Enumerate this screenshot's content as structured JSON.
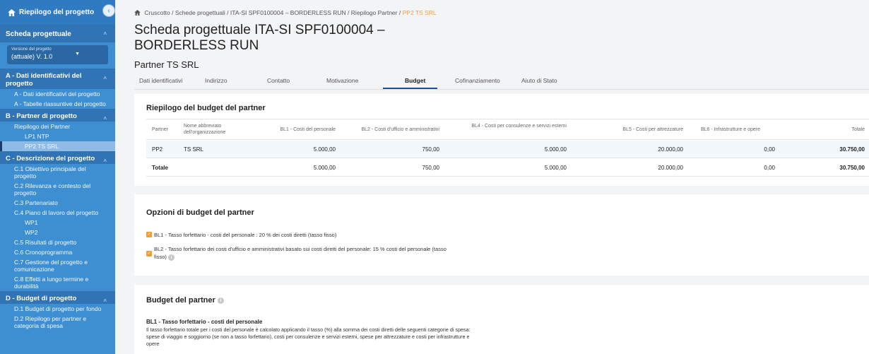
{
  "sidebar": {
    "header": "Riepilogo del progetto",
    "collapse_icon": "‹",
    "section_title": "Scheda progettuale",
    "version_label": "Versione del progetto",
    "version_value": "(attuale) V. 1.0",
    "groups": {
      "a": "A - Dati identificativi del progetto",
      "a_items": [
        "A - Dati identificativi del progetto",
        "A - Tabelle riassuntive del progetto"
      ],
      "b": "B - Partner di progetto",
      "b_item": "Riepilogo dei Partner",
      "b_subs": [
        "LP1 NTP",
        "PP2 TS SRL"
      ],
      "c": "C - Descrizione del progetto",
      "c_items": [
        "C.1 Obiettivo principale del progetto",
        "C.2 Rilevanza e contesto del progetto",
        "C.3 Partenariato",
        "C.4 Piano di lavoro del progetto"
      ],
      "c_subs": [
        "WP1",
        "WP2"
      ],
      "c_items2": [
        "C.5 Risultati di progetto",
        "C.6 Cronoprogramma",
        "C.7 Gestione del progetto e comunicazione",
        "C.8 Effetti a lungo termine e durabilità"
      ],
      "d": "D - Budget di progetto",
      "d_items": [
        "D.1 Budget di progetto per fondo",
        "D.2 Riepilogo per partner e categoria di spesa"
      ]
    }
  },
  "breadcrumb": {
    "items": [
      "Cruscotto",
      "Schede progettuali",
      "ITA-SI SPF0100004 – BORDERLESS RUN",
      "Riepilogo Partner"
    ],
    "current": "PP2 TS SRL",
    "sep": "/"
  },
  "page_title": "Scheda progettuale ITA-SI SPF0100004 – BORDERLESS RUN",
  "partner_title": "Partner TS SRL",
  "tabs": [
    "Dati identificativi",
    "Indirizzo",
    "Contatto",
    "Motivazione",
    "Budget",
    "Cofinanziamento",
    "Aiuto di Stato"
  ],
  "budget_summary": {
    "title": "Riepilogo del budget del partner",
    "headers": [
      "Partner",
      "Nome abbreviato dell'organizzazione",
      "BL1 - Costi del personale",
      "BL2 - Costi d'ufficio e amministrativi",
      "BL4 - Costi per consulenze e servizi esterni",
      "BL5 - Costi per attrezzature",
      "BL6 - Infrastrutture e opere",
      "Totale"
    ],
    "row": [
      "PP2",
      "TS SRL",
      "5.000,00",
      "750,00",
      "5.000,00",
      "20.000,00",
      "0,00",
      "30.750,00"
    ],
    "total_row": [
      "Totale",
      "5.000,00",
      "750,00",
      "5.000,00",
      "20.000,00",
      "0,00",
      "30.750,00"
    ]
  },
  "options": {
    "title": "Opzioni di budget del partner",
    "bl1": "BL1 - Tasso forfettario - costi del personale : 20 % dei costi diretti (tasso fisso)",
    "bl2": "BL2 - Tasso forfettario dei costi d'ufficio e amministrativi basato sui costi diretti del personale: 15 % costi del personale (tasso fisso)",
    "check": "✓",
    "info": "i"
  },
  "partner_budget": {
    "title": "Budget del partner",
    "bl1_title": "BL1 - Tasso forfettario - costi del personale",
    "bl1_text": "Il tasso forfettario totale per i costi del personale è calcolato applicando il tasso (%) alla somma dei costi diretti delle seguenti categorie di spesa: spese di viaggio e soggiorno (se non a tasso forfettario), costi per consulenze e servizi esterni, spese per attrezzature e costi per infrastrutture e opere"
  },
  "colors": {
    "sidebar": "#3d8fd1",
    "accent": "#f0a030",
    "tab_active": "#1e4f8a"
  }
}
